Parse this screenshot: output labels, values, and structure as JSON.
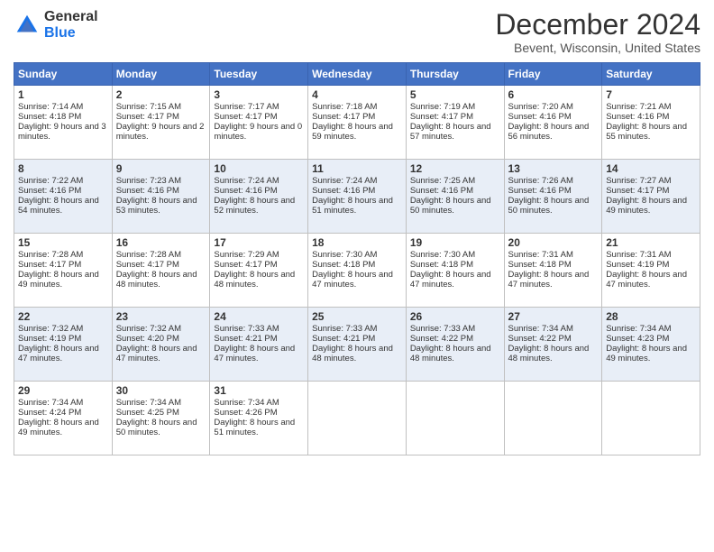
{
  "header": {
    "logo_general": "General",
    "logo_blue": "Blue",
    "month_title": "December 2024",
    "location": "Bevent, Wisconsin, United States"
  },
  "days_of_week": [
    "Sunday",
    "Monday",
    "Tuesday",
    "Wednesday",
    "Thursday",
    "Friday",
    "Saturday"
  ],
  "weeks": [
    [
      {
        "day": "1",
        "sunrise": "Sunrise: 7:14 AM",
        "sunset": "Sunset: 4:18 PM",
        "daylight": "Daylight: 9 hours and 3 minutes."
      },
      {
        "day": "2",
        "sunrise": "Sunrise: 7:15 AM",
        "sunset": "Sunset: 4:17 PM",
        "daylight": "Daylight: 9 hours and 2 minutes."
      },
      {
        "day": "3",
        "sunrise": "Sunrise: 7:17 AM",
        "sunset": "Sunset: 4:17 PM",
        "daylight": "Daylight: 9 hours and 0 minutes."
      },
      {
        "day": "4",
        "sunrise": "Sunrise: 7:18 AM",
        "sunset": "Sunset: 4:17 PM",
        "daylight": "Daylight: 8 hours and 59 minutes."
      },
      {
        "day": "5",
        "sunrise": "Sunrise: 7:19 AM",
        "sunset": "Sunset: 4:17 PM",
        "daylight": "Daylight: 8 hours and 57 minutes."
      },
      {
        "day": "6",
        "sunrise": "Sunrise: 7:20 AM",
        "sunset": "Sunset: 4:16 PM",
        "daylight": "Daylight: 8 hours and 56 minutes."
      },
      {
        "day": "7",
        "sunrise": "Sunrise: 7:21 AM",
        "sunset": "Sunset: 4:16 PM",
        "daylight": "Daylight: 8 hours and 55 minutes."
      }
    ],
    [
      {
        "day": "8",
        "sunrise": "Sunrise: 7:22 AM",
        "sunset": "Sunset: 4:16 PM",
        "daylight": "Daylight: 8 hours and 54 minutes."
      },
      {
        "day": "9",
        "sunrise": "Sunrise: 7:23 AM",
        "sunset": "Sunset: 4:16 PM",
        "daylight": "Daylight: 8 hours and 53 minutes."
      },
      {
        "day": "10",
        "sunrise": "Sunrise: 7:24 AM",
        "sunset": "Sunset: 4:16 PM",
        "daylight": "Daylight: 8 hours and 52 minutes."
      },
      {
        "day": "11",
        "sunrise": "Sunrise: 7:24 AM",
        "sunset": "Sunset: 4:16 PM",
        "daylight": "Daylight: 8 hours and 51 minutes."
      },
      {
        "day": "12",
        "sunrise": "Sunrise: 7:25 AM",
        "sunset": "Sunset: 4:16 PM",
        "daylight": "Daylight: 8 hours and 50 minutes."
      },
      {
        "day": "13",
        "sunrise": "Sunrise: 7:26 AM",
        "sunset": "Sunset: 4:16 PM",
        "daylight": "Daylight: 8 hours and 50 minutes."
      },
      {
        "day": "14",
        "sunrise": "Sunrise: 7:27 AM",
        "sunset": "Sunset: 4:17 PM",
        "daylight": "Daylight: 8 hours and 49 minutes."
      }
    ],
    [
      {
        "day": "15",
        "sunrise": "Sunrise: 7:28 AM",
        "sunset": "Sunset: 4:17 PM",
        "daylight": "Daylight: 8 hours and 49 minutes."
      },
      {
        "day": "16",
        "sunrise": "Sunrise: 7:28 AM",
        "sunset": "Sunset: 4:17 PM",
        "daylight": "Daylight: 8 hours and 48 minutes."
      },
      {
        "day": "17",
        "sunrise": "Sunrise: 7:29 AM",
        "sunset": "Sunset: 4:17 PM",
        "daylight": "Daylight: 8 hours and 48 minutes."
      },
      {
        "day": "18",
        "sunrise": "Sunrise: 7:30 AM",
        "sunset": "Sunset: 4:18 PM",
        "daylight": "Daylight: 8 hours and 47 minutes."
      },
      {
        "day": "19",
        "sunrise": "Sunrise: 7:30 AM",
        "sunset": "Sunset: 4:18 PM",
        "daylight": "Daylight: 8 hours and 47 minutes."
      },
      {
        "day": "20",
        "sunrise": "Sunrise: 7:31 AM",
        "sunset": "Sunset: 4:18 PM",
        "daylight": "Daylight: 8 hours and 47 minutes."
      },
      {
        "day": "21",
        "sunrise": "Sunrise: 7:31 AM",
        "sunset": "Sunset: 4:19 PM",
        "daylight": "Daylight: 8 hours and 47 minutes."
      }
    ],
    [
      {
        "day": "22",
        "sunrise": "Sunrise: 7:32 AM",
        "sunset": "Sunset: 4:19 PM",
        "daylight": "Daylight: 8 hours and 47 minutes."
      },
      {
        "day": "23",
        "sunrise": "Sunrise: 7:32 AM",
        "sunset": "Sunset: 4:20 PM",
        "daylight": "Daylight: 8 hours and 47 minutes."
      },
      {
        "day": "24",
        "sunrise": "Sunrise: 7:33 AM",
        "sunset": "Sunset: 4:21 PM",
        "daylight": "Daylight: 8 hours and 47 minutes."
      },
      {
        "day": "25",
        "sunrise": "Sunrise: 7:33 AM",
        "sunset": "Sunset: 4:21 PM",
        "daylight": "Daylight: 8 hours and 48 minutes."
      },
      {
        "day": "26",
        "sunrise": "Sunrise: 7:33 AM",
        "sunset": "Sunset: 4:22 PM",
        "daylight": "Daylight: 8 hours and 48 minutes."
      },
      {
        "day": "27",
        "sunrise": "Sunrise: 7:34 AM",
        "sunset": "Sunset: 4:22 PM",
        "daylight": "Daylight: 8 hours and 48 minutes."
      },
      {
        "day": "28",
        "sunrise": "Sunrise: 7:34 AM",
        "sunset": "Sunset: 4:23 PM",
        "daylight": "Daylight: 8 hours and 49 minutes."
      }
    ],
    [
      {
        "day": "29",
        "sunrise": "Sunrise: 7:34 AM",
        "sunset": "Sunset: 4:24 PM",
        "daylight": "Daylight: 8 hours and 49 minutes."
      },
      {
        "day": "30",
        "sunrise": "Sunrise: 7:34 AM",
        "sunset": "Sunset: 4:25 PM",
        "daylight": "Daylight: 8 hours and 50 minutes."
      },
      {
        "day": "31",
        "sunrise": "Sunrise: 7:34 AM",
        "sunset": "Sunset: 4:26 PM",
        "daylight": "Daylight: 8 hours and 51 minutes."
      },
      null,
      null,
      null,
      null
    ]
  ]
}
